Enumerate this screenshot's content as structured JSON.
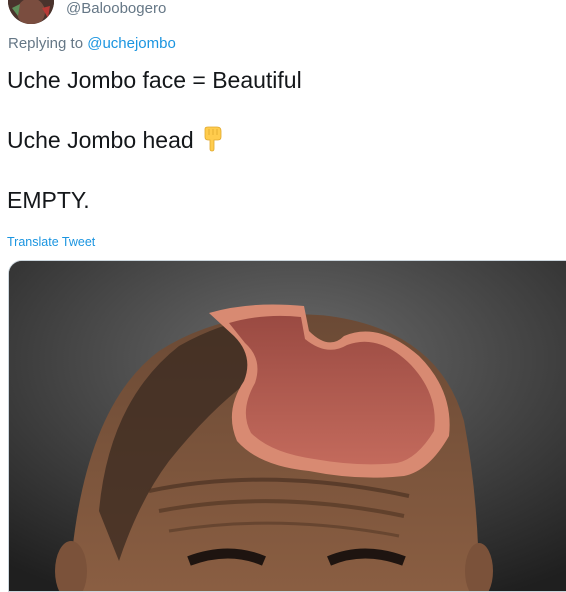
{
  "tweet": {
    "handle": "@Baloobogero",
    "replying_prefix": "Replying to ",
    "replying_to": "@uchejombo",
    "text_line_1": "Uche Jombo face = Beautiful",
    "text_line_2": "Uche Jombo head",
    "text_line_2_emoji": "pointing-down-icon",
    "text_line_3": "EMPTY.",
    "translate_label": "Translate Tweet"
  },
  "colors": {
    "link": "#1b95e0",
    "secondary_text": "#657786",
    "primary_text": "#14171a"
  }
}
